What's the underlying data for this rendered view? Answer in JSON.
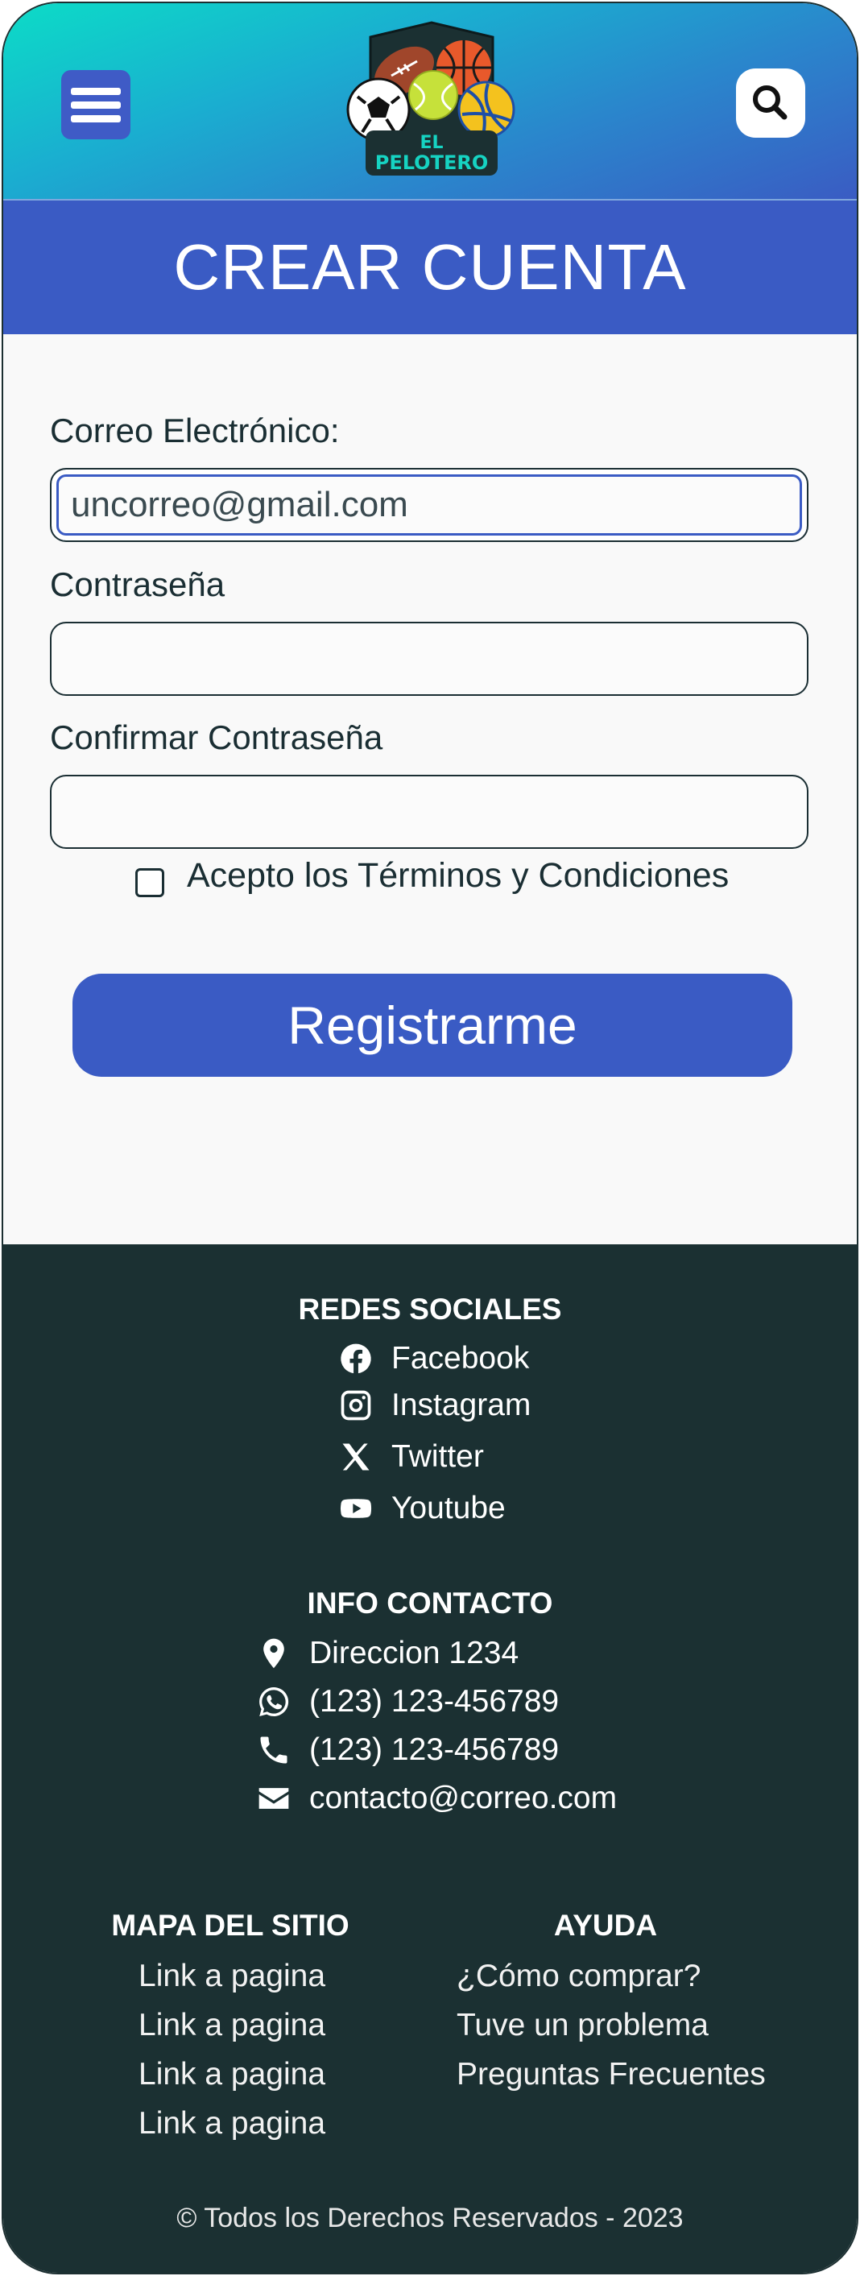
{
  "header": {
    "logo_top": "EL",
    "logo_bottom": "PELOTERO",
    "menu_icon": "hamburger-menu-icon",
    "search_icon": "search-icon"
  },
  "page": {
    "title": "CREAR CUENTA"
  },
  "form": {
    "email_label": "Correo Electrónico:",
    "email_value": "uncorreo@gmail.com",
    "password_label": "Contraseña",
    "password_value": "",
    "confirm_label": "Confirmar Contraseña",
    "confirm_value": "",
    "terms_label": "Acepto los Términos y Condiciones",
    "terms_checked": false,
    "submit_label": "Registrarme"
  },
  "colors": {
    "brand_blue": "#3a5bc4",
    "header_gradient_start": "#0cdcc7",
    "footer_bg": "#1b3032"
  },
  "footer": {
    "social": {
      "heading": "REDES SOCIALES",
      "items": [
        {
          "label": "Facebook",
          "icon": "facebook-icon"
        },
        {
          "label": "Instagram",
          "icon": "instagram-icon"
        },
        {
          "label": "Twitter",
          "icon": "x-twitter-icon"
        },
        {
          "label": "Youtube",
          "icon": "youtube-icon"
        }
      ]
    },
    "contact": {
      "heading": "INFO CONTACTO",
      "items": [
        {
          "label": "Direccion 1234",
          "icon": "map-pin-icon"
        },
        {
          "label": "(123) 123-456789",
          "icon": "whatsapp-icon"
        },
        {
          "label": "(123) 123-456789",
          "icon": "phone-icon"
        },
        {
          "label": "contacto@correo.com",
          "icon": "envelope-icon"
        }
      ]
    },
    "sitemap": {
      "heading": "MAPA DEL SITIO",
      "links": [
        "Link a pagina",
        "Link a pagina",
        "Link a pagina",
        "Link a pagina"
      ]
    },
    "help": {
      "heading": "AYUDA",
      "links": [
        "¿Cómo comprar?",
        "Tuve un problema",
        "Preguntas Frecuentes"
      ]
    },
    "copyright": "© Todos los Derechos Reservados - 2023"
  }
}
